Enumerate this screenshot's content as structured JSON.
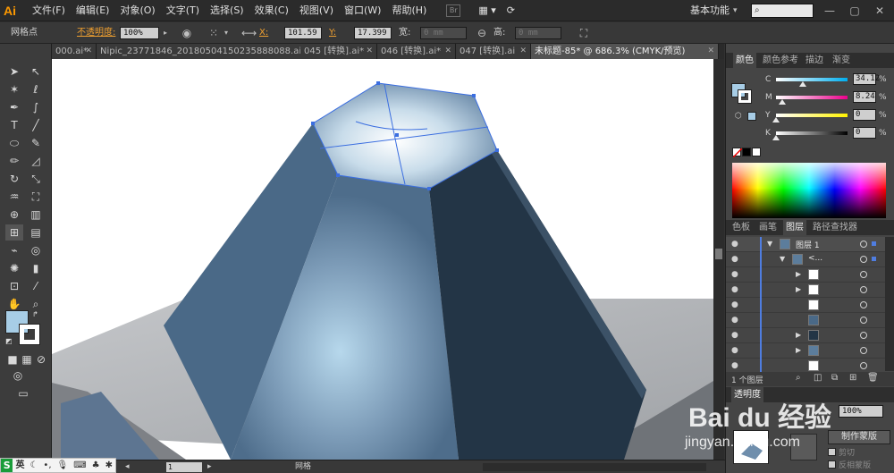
{
  "app": {
    "logo": "Ai",
    "workspace": "基本功能"
  },
  "menu": [
    "文件(F)",
    "编辑(E)",
    "对象(O)",
    "文字(T)",
    "选择(S)",
    "效果(C)",
    "视图(V)",
    "窗口(W)",
    "帮助(H)"
  ],
  "bridge_badge": "Br",
  "window_controls": {
    "minimize": "—",
    "restore": "▢",
    "close": "✕"
  },
  "control": {
    "object_type": "网格点",
    "opacity_label": "不透明度:",
    "opacity_value": "100%",
    "x_label": "X:",
    "x_value": "101.59",
    "y_label": "Y:",
    "y_value": "17.399",
    "w_label": "宽:",
    "w_value": "0 mm",
    "h_label": "高:",
    "h_value": "0 mm"
  },
  "tabs": [
    {
      "label": "000.ai*"
    },
    {
      "label": "Nipic_23771846_20180504150235888088.ai*"
    },
    {
      "label": "045 [转换].ai*"
    },
    {
      "label": "046 [转换].ai*"
    },
    {
      "label": "047 [转换].ai"
    },
    {
      "label": "未标题-85* @ 686.3% (CMYK/预览)"
    }
  ],
  "color_panel": {
    "tabs": [
      "颜色",
      "颜色参考",
      "描边",
      "渐变"
    ],
    "channels": [
      {
        "name": "C",
        "value": "34.12",
        "frac": 0.3412,
        "color": "#00aeef"
      },
      {
        "name": "M",
        "value": "8.24",
        "frac": 0.0824,
        "color": "#ec008c"
      },
      {
        "name": "Y",
        "value": "0",
        "frac": 0.0,
        "color": "#fff200"
      },
      {
        "name": "K",
        "value": "0",
        "frac": 0.0,
        "color": "#888888"
      }
    ],
    "percent": "%",
    "fill_color": "#a7cde6"
  },
  "layers_panel": {
    "tabs": [
      "色板",
      "画笔",
      "图层",
      "路径查找器"
    ],
    "top_layer": "图层 1",
    "group_label": "<...",
    "footer": "1 个图层"
  },
  "transparency_panel": {
    "tab": "透明度",
    "opacity": "100%",
    "make_mask": "制作蒙版",
    "clip": "剪切",
    "invert": "反相蒙版"
  },
  "status": {
    "page": "1",
    "mode": "网格"
  },
  "ime": {
    "s": "S",
    "lang": "英"
  },
  "watermark": {
    "brand": "Bai  du 经验",
    "url": "jingyan.baidu.com"
  }
}
